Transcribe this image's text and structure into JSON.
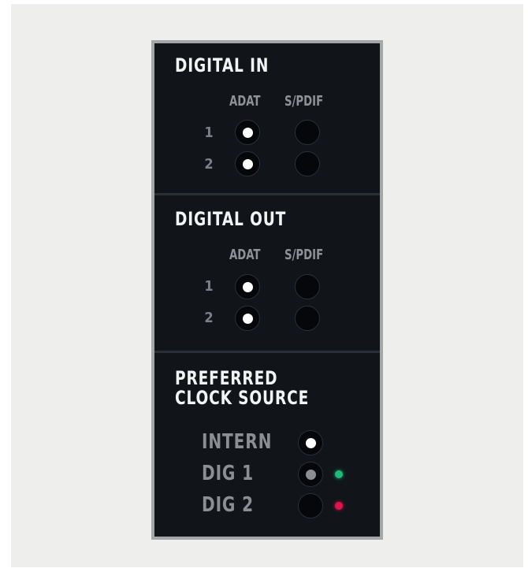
{
  "colors": {
    "panel_bg": "#11151a",
    "panel_border": "#a4a6a8",
    "led_on": "#ffffff",
    "led_dim": "#8a8d92",
    "status_green": "#1fb97a",
    "status_red": "#e3124d"
  },
  "digital_in": {
    "title": "DIGITAL IN",
    "columns": [
      "ADAT",
      "S/PDIF"
    ],
    "rows": [
      {
        "label": "1",
        "adat": true,
        "spdif": false
      },
      {
        "label": "2",
        "adat": true,
        "spdif": false
      }
    ]
  },
  "digital_out": {
    "title": "DIGITAL OUT",
    "columns": [
      "ADAT",
      "S/PDIF"
    ],
    "rows": [
      {
        "label": "1",
        "adat": true,
        "spdif": false
      },
      {
        "label": "2",
        "adat": true,
        "spdif": false
      }
    ]
  },
  "clock": {
    "title_line1": "PREFERRED",
    "title_line2": "CLOCK SOURCE",
    "options": [
      {
        "label": "INTERN",
        "state": "selected",
        "status": "none"
      },
      {
        "label": "DIG 1",
        "state": "dim",
        "status": "green"
      },
      {
        "label": "DIG 2",
        "state": "off",
        "status": "red"
      }
    ]
  }
}
